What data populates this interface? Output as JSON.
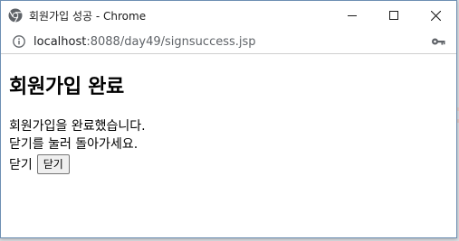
{
  "window": {
    "title": "회원가입 성공 - Chrome",
    "controls": {
      "minimize_icon": "minimize-icon",
      "maximize_icon": "maximize-icon",
      "close_icon": "close-icon"
    }
  },
  "address_bar": {
    "url_host": "localhost",
    "url_rest": ":8088/day49/signsuccess.jsp",
    "info_icon": "info-icon",
    "key_icon": "key-icon"
  },
  "page": {
    "heading": "회원가입 완료",
    "lines": [
      "회원가입을 완료했습니다.",
      "닫기를 눌러 돌아가세요."
    ],
    "close_label": "닫기",
    "close_button_label": "닫기"
  },
  "colors": {
    "window_border": "#6d8fb3",
    "desktop_strip_top": "#e7c7b8",
    "desktop_strip_mid": "#d9c6c0"
  }
}
